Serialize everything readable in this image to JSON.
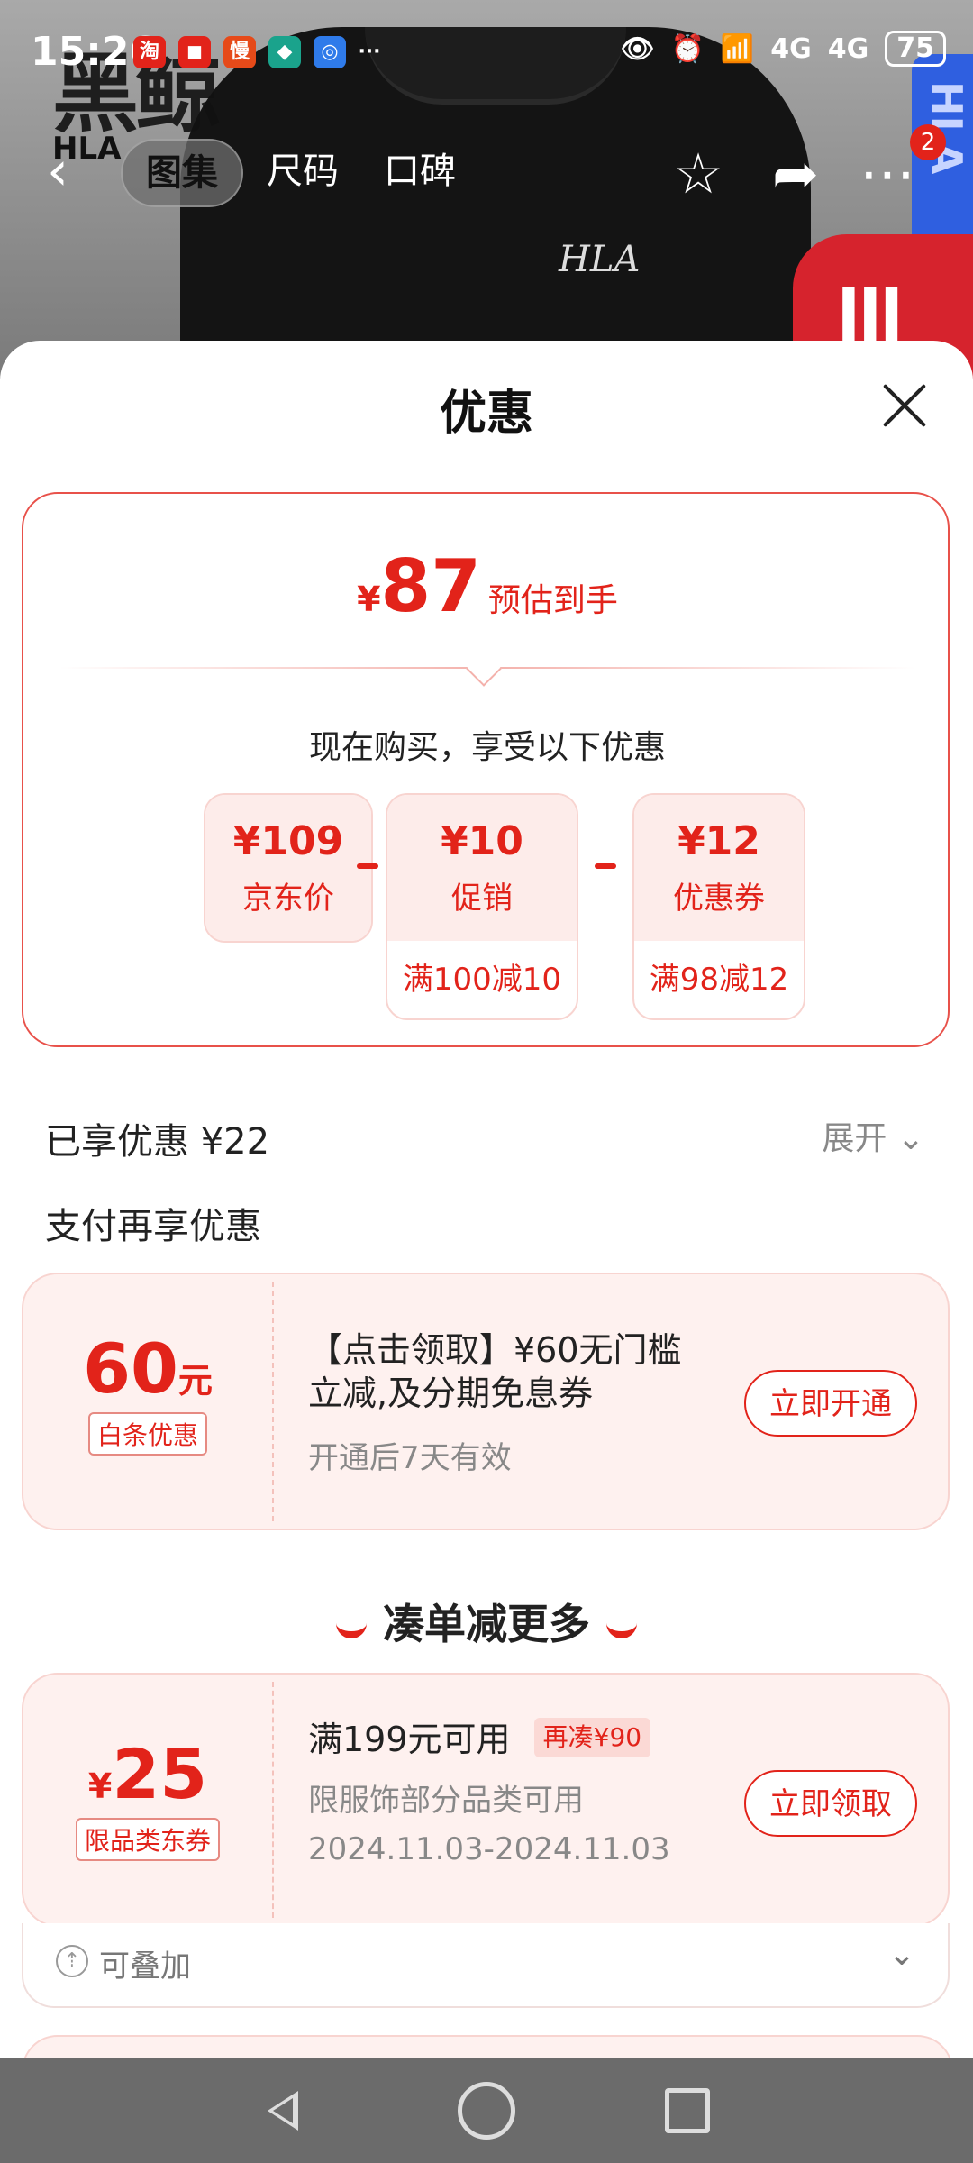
{
  "status_bar": {
    "time": "15:26",
    "apps": [
      "淘",
      "◼",
      "慢",
      "◆",
      "◎"
    ],
    "more": "···",
    "network": "4G",
    "network2": "4G",
    "battery": "75"
  },
  "background": {
    "brand_logo": "黑鲸",
    "brand_sub": "HLA",
    "shirt_logo": "HLA",
    "side_banner": "HLA"
  },
  "top_nav": {
    "back": "‹",
    "tabs": [
      "图集",
      "尺码",
      "口碑"
    ],
    "cart_badge": "2"
  },
  "sheet": {
    "title": "优惠",
    "estimate": {
      "currency": "¥",
      "price": "87",
      "label": "预估到手"
    },
    "buy_now": "现在购买，享受以下优惠",
    "breakdown": [
      {
        "value": "¥109",
        "name": "京东价"
      },
      {
        "value": "¥10",
        "name": "促销",
        "condition": "满100减10"
      },
      {
        "value": "¥12",
        "name": "优惠券",
        "condition": "满98减12"
      }
    ],
    "enjoyed": "已享优惠 ¥22",
    "expand": "展开",
    "pay_more": "支付再享优惠",
    "baitiao": {
      "amount": "60",
      "unit": "元",
      "tag": "白条优惠",
      "title_line1": "【点击领取】¥60无门槛",
      "title_line2": "立减,及分期免息券",
      "sub": "开通后7天有效",
      "button": "立即开通"
    },
    "more_section_title": "凑单减更多",
    "jd_coupon": {
      "currency": "¥",
      "amount": "25",
      "tag": "限品类东券",
      "title": "满199元可用",
      "extra_tag": "再凑¥90",
      "scope": "限服饰部分品类可用",
      "dates": "2024.11.03-2024.11.03",
      "button": "立即领取",
      "stackable": "可叠加"
    }
  },
  "colors": {
    "accent": "#e2231a",
    "coupon_bg": "#fef1ef",
    "border": "#f8d4d0"
  }
}
